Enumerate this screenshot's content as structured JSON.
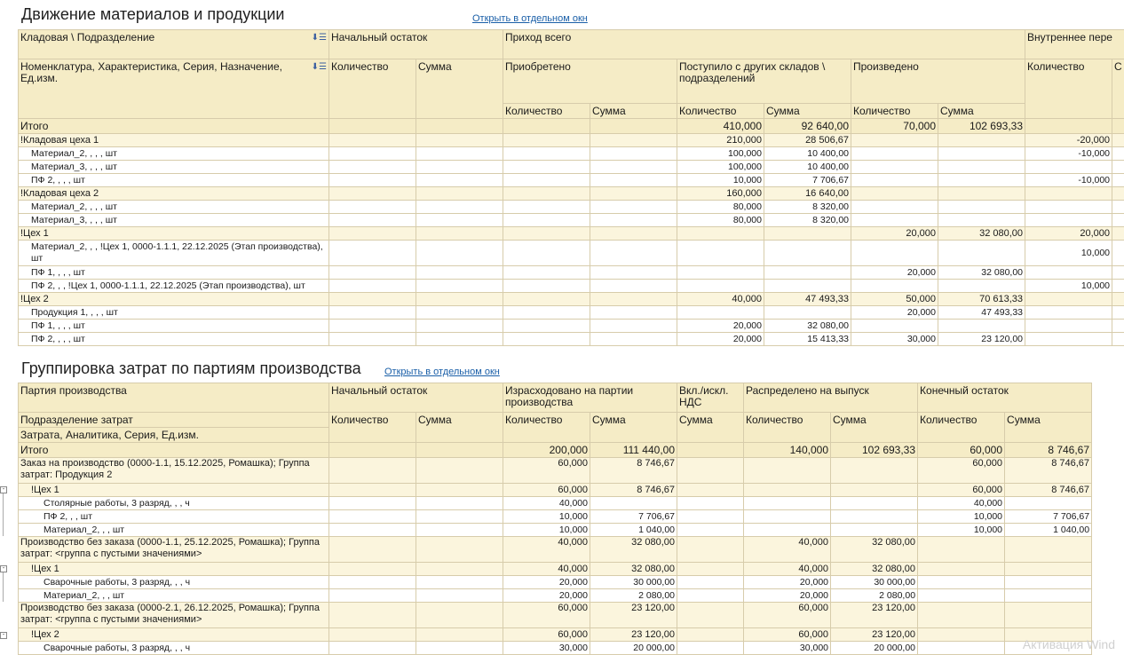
{
  "section1": {
    "title": "Движение материалов и продукции",
    "open_link": "Открыть в отдельном окн",
    "headers": {
      "group_dim": "Кладовая \\ Подразделение",
      "item_dim": "Номенклатура, Характеристика, Серия, Назначение, Ед.изм.",
      "opening": "Начальный остаток",
      "income_total": "Приход всего",
      "internal": "Внутреннее пере",
      "quantity": "Количество",
      "sum": "Сумма",
      "purchased": "Приобретено",
      "from_other": "Поступило с других складов \\ подразделений",
      "produced": "Произведено",
      "cut_col": "С"
    },
    "total": {
      "label": "Итого",
      "from_q": "410,000",
      "from_s": "92 640,00",
      "prod_q": "70,000",
      "prod_s": "102 693,33",
      "int_q": ""
    },
    "rows": [
      {
        "kind": "grp",
        "label": "!Кладовая цеха 1",
        "from_q": "210,000",
        "from_s": "28 506,67",
        "prod_q": "",
        "prod_s": "",
        "int_q": "-20,000"
      },
      {
        "kind": "det",
        "label": "Материал_2, , , , шт",
        "from_q": "100,000",
        "from_s": "10 400,00",
        "prod_q": "",
        "prod_s": "",
        "int_q": "-10,000"
      },
      {
        "kind": "det",
        "label": "Материал_3, , , , шт",
        "from_q": "100,000",
        "from_s": "10 400,00",
        "prod_q": "",
        "prod_s": "",
        "int_q": ""
      },
      {
        "kind": "det",
        "label": "ПФ 2, , , , шт",
        "from_q": "10,000",
        "from_s": "7 706,67",
        "prod_q": "",
        "prod_s": "",
        "int_q": "-10,000"
      },
      {
        "kind": "grp",
        "label": "!Кладовая цеха 2",
        "from_q": "160,000",
        "from_s": "16 640,00",
        "prod_q": "",
        "prod_s": "",
        "int_q": ""
      },
      {
        "kind": "det",
        "label": "Материал_2, , , , шт",
        "from_q": "80,000",
        "from_s": "8 320,00",
        "prod_q": "",
        "prod_s": "",
        "int_q": ""
      },
      {
        "kind": "det",
        "label": "Материал_3, , , , шт",
        "from_q": "80,000",
        "from_s": "8 320,00",
        "prod_q": "",
        "prod_s": "",
        "int_q": ""
      },
      {
        "kind": "grp",
        "label": "!Цех 1",
        "from_q": "",
        "from_s": "",
        "prod_q": "20,000",
        "prod_s": "32 080,00",
        "int_q": "20,000"
      },
      {
        "kind": "det",
        "label": "Материал_2, , , !Цех 1, 0000-1.1.1, 22.12.2025 (Этап производства), шт",
        "wrap": true,
        "from_q": "",
        "from_s": "",
        "prod_q": "",
        "prod_s": "",
        "int_q": "10,000"
      },
      {
        "kind": "det",
        "label": "ПФ 1, , , , шт",
        "from_q": "",
        "from_s": "",
        "prod_q": "20,000",
        "prod_s": "32 080,00",
        "int_q": ""
      },
      {
        "kind": "det",
        "label": "ПФ 2, , , !Цех 1, 0000-1.1.1, 22.12.2025 (Этап производства), шт",
        "from_q": "",
        "from_s": "",
        "prod_q": "",
        "prod_s": "",
        "int_q": "10,000"
      },
      {
        "kind": "grp",
        "label": "!Цех 2",
        "from_q": "40,000",
        "from_s": "47 493,33",
        "prod_q": "50,000",
        "prod_s": "70 613,33",
        "int_q": ""
      },
      {
        "kind": "det",
        "label": "Продукция 1, , , , шт",
        "from_q": "",
        "from_s": "",
        "prod_q": "20,000",
        "prod_s": "47 493,33",
        "int_q": ""
      },
      {
        "kind": "det",
        "label": "ПФ 1, , , , шт",
        "from_q": "20,000",
        "from_s": "32 080,00",
        "prod_q": "",
        "prod_s": "",
        "int_q": ""
      },
      {
        "kind": "det",
        "label": "ПФ 2, , , , шт",
        "from_q": "20,000",
        "from_s": "15 413,33",
        "prod_q": "30,000",
        "prod_s": "23 120,00",
        "int_q": ""
      }
    ]
  },
  "section2": {
    "title": "Группировка затрат по партиям производства",
    "open_link": "Открыть в отдельном окн",
    "headers": {
      "batch": "Партия производства",
      "dept": "Подразделение затрат",
      "cost": "Затрата, Аналитика, Серия, Ед.изм.",
      "opening": "Начальный остаток",
      "spent": "Израсходовано на партии производства",
      "vat": "Вкл./искл. НДС",
      "distributed": "Распределено на выпуск",
      "closing": "Конечный остаток",
      "quantity": "Количество",
      "sum": "Сумма"
    },
    "total": {
      "label": "Итого",
      "sp_q": "200,000",
      "sp_s": "111 440,00",
      "ds_q": "140,000",
      "ds_s": "102 693,33",
      "cl_q": "60,000",
      "cl_s": "8 746,67"
    },
    "rows": [
      {
        "kind": "grp",
        "lvl": 0,
        "label": "Заказ на производство (0000-1.1, 15.12.2025, Ромашка); Группа затрат: Продукция 2",
        "sp_q": "60,000",
        "sp_s": "8 746,67",
        "ds_q": "",
        "ds_s": "",
        "cl_q": "60,000",
        "cl_s": "8 746,67"
      },
      {
        "kind": "grp",
        "lvl": 1,
        "label": "!Цех 1",
        "sp_q": "60,000",
        "sp_s": "8 746,67",
        "ds_q": "",
        "ds_s": "",
        "cl_q": "60,000",
        "cl_s": "8 746,67"
      },
      {
        "kind": "det",
        "lvl": 2,
        "label": "Столярные работы, 3 разряд, , , ч",
        "sp_q": "40,000",
        "sp_s": "",
        "ds_q": "",
        "ds_s": "",
        "cl_q": "40,000",
        "cl_s": ""
      },
      {
        "kind": "det",
        "lvl": 2,
        "label": "ПФ 2, , , шт",
        "sp_q": "10,000",
        "sp_s": "7 706,67",
        "ds_q": "",
        "ds_s": "",
        "cl_q": "10,000",
        "cl_s": "7 706,67"
      },
      {
        "kind": "det",
        "lvl": 2,
        "label": "Материал_2, , , шт",
        "sp_q": "10,000",
        "sp_s": "1 040,00",
        "ds_q": "",
        "ds_s": "",
        "cl_q": "10,000",
        "cl_s": "1 040,00"
      },
      {
        "kind": "grp",
        "lvl": 0,
        "label": "Производство без заказа (0000-1.1, 25.12.2025, Ромашка); Группа затрат: <группа с пустыми значениями>",
        "sp_q": "40,000",
        "sp_s": "32 080,00",
        "ds_q": "40,000",
        "ds_s": "32 080,00",
        "cl_q": "",
        "cl_s": ""
      },
      {
        "kind": "grp",
        "lvl": 1,
        "label": "!Цех 1",
        "sp_q": "40,000",
        "sp_s": "32 080,00",
        "ds_q": "40,000",
        "ds_s": "32 080,00",
        "cl_q": "",
        "cl_s": ""
      },
      {
        "kind": "det",
        "lvl": 2,
        "label": "Сварочные работы, 3 разряд, , , ч",
        "sp_q": "20,000",
        "sp_s": "30 000,00",
        "ds_q": "20,000",
        "ds_s": "30 000,00",
        "cl_q": "",
        "cl_s": ""
      },
      {
        "kind": "det",
        "lvl": 2,
        "label": "Материал_2, , , шт",
        "sp_q": "20,000",
        "sp_s": "2 080,00",
        "ds_q": "20,000",
        "ds_s": "2 080,00",
        "cl_q": "",
        "cl_s": ""
      },
      {
        "kind": "grp",
        "lvl": 0,
        "label": "Производство без заказа (0000-2.1, 26.12.2025, Ромашка); Группа затрат: <группа с пустыми значениями>",
        "sp_q": "60,000",
        "sp_s": "23 120,00",
        "ds_q": "60,000",
        "ds_s": "23 120,00",
        "cl_q": "",
        "cl_s": ""
      },
      {
        "kind": "grp",
        "lvl": 1,
        "label": "!Цех 2",
        "sp_q": "60,000",
        "sp_s": "23 120,00",
        "ds_q": "60,000",
        "ds_s": "23 120,00",
        "cl_q": "",
        "cl_s": ""
      },
      {
        "kind": "det",
        "lvl": 2,
        "label": "Сварочные работы, 3 разряд, , , ч",
        "sp_q": "30,000",
        "sp_s": "20 000,00",
        "ds_q": "30,000",
        "ds_s": "20 000,00",
        "cl_q": "",
        "cl_s": ""
      }
    ]
  },
  "watermark": "Активация Wind"
}
